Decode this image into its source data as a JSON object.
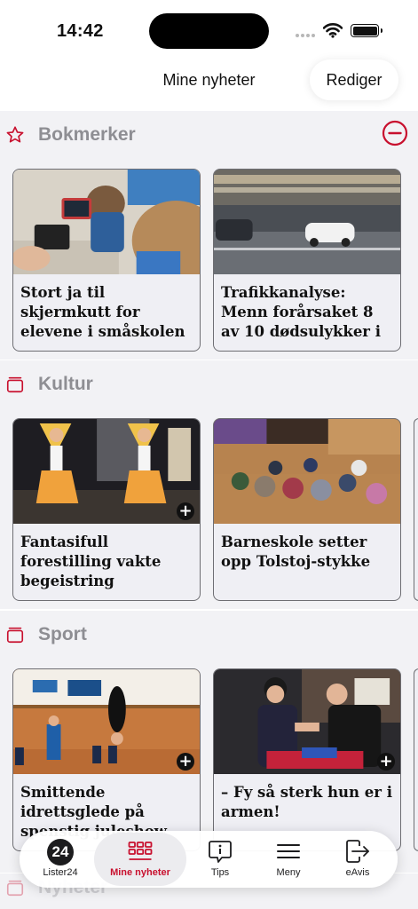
{
  "status_bar": {
    "time": "14:42"
  },
  "nav": {
    "title": "Mine nyheter",
    "edit_label": "Rediger"
  },
  "colors": {
    "accent": "#c8102e",
    "section_bg": "#f2f2f5",
    "section_label": "#8e8e93"
  },
  "sections": [
    {
      "label": "Bokmerker",
      "icon": "star-icon",
      "cards": [
        {
          "title": "Stort ja til skjermkutt for elevene i småskolen",
          "image": "children-with-tablets"
        },
        {
          "title": "Trafikkanalyse: Menn forårsaket 8 av 10 dødsulykker i",
          "image": "cars-on-highway-at-night"
        }
      ]
    },
    {
      "label": "Kultur",
      "icon": "category-icon",
      "cards": [
        {
          "title": "Fantasifull forestilling vakte begeistring",
          "image": "dancers-on-stage"
        },
        {
          "title": "Barneskole setter opp Tolstoj-stykke",
          "image": "children-sitting-in-gym"
        }
      ]
    },
    {
      "label": "Sport",
      "icon": "category-icon",
      "cards": [
        {
          "title": "Smittende idrettsglede på spenstig juleshow",
          "image": "gymnast-flip-in-hall"
        },
        {
          "title": "– Fy så sterk hun er i armen!",
          "image": "arm-wrestling-match"
        }
      ]
    },
    {
      "label": "Nyheter",
      "icon": "category-icon"
    }
  ],
  "tabbar": {
    "items": [
      {
        "label": "Lister24",
        "icon": "24-badge-icon"
      },
      {
        "label": "Mine nyheter",
        "icon": "grid-icon",
        "active": true
      },
      {
        "label": "Tips",
        "icon": "info-bubble-icon"
      },
      {
        "label": "Meny",
        "icon": "hamburger-menu-icon"
      },
      {
        "label": "eAvis",
        "icon": "exit-arrow-icon"
      }
    ],
    "badge_text": "24"
  }
}
